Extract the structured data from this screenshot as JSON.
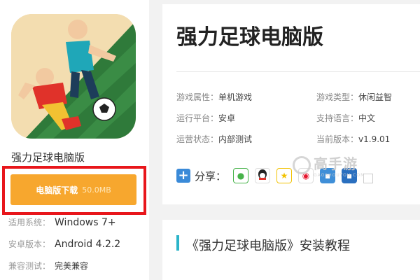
{
  "app": {
    "name": "强力足球电脑版",
    "download_label": "电脑版下载",
    "download_size": "50.0MB",
    "meta": [
      {
        "key": "适用系统：",
        "value": "Windows 7+"
      },
      {
        "key": "安卓版本：",
        "value": "Android 4.2.2"
      },
      {
        "key": "兼容测试：",
        "value": "完美兼容"
      }
    ]
  },
  "detail": {
    "title": "强力足球电脑版",
    "info": [
      {
        "key": "游戏属性：",
        "value": "单机游戏"
      },
      {
        "key": "游戏类型：",
        "value": "休闲益智"
      },
      {
        "key": "运行平台：",
        "value": "安卓"
      },
      {
        "key": "支持语言：",
        "value": "中文"
      },
      {
        "key": "运营状态：",
        "value": "内部测试"
      },
      {
        "key": "当前版本：",
        "value": "v1.9.01"
      }
    ],
    "share_label": "分享：",
    "share_icons": [
      "wechat-icon",
      "qq-icon",
      "qzone-icon",
      "weibo-icon",
      "tencent-weibo-icon",
      "renren-icon",
      "more-icon"
    ]
  },
  "watermark": {
    "cn": "高手游",
    "en": "GAOSHOUYOU.COM"
  },
  "tutorial": {
    "title": "《强力足球电脑版》安装教程"
  },
  "colors": {
    "download": "#f7a72e",
    "highlight_frame": "#e8161b",
    "accent_bar": "#2bb4c9"
  }
}
